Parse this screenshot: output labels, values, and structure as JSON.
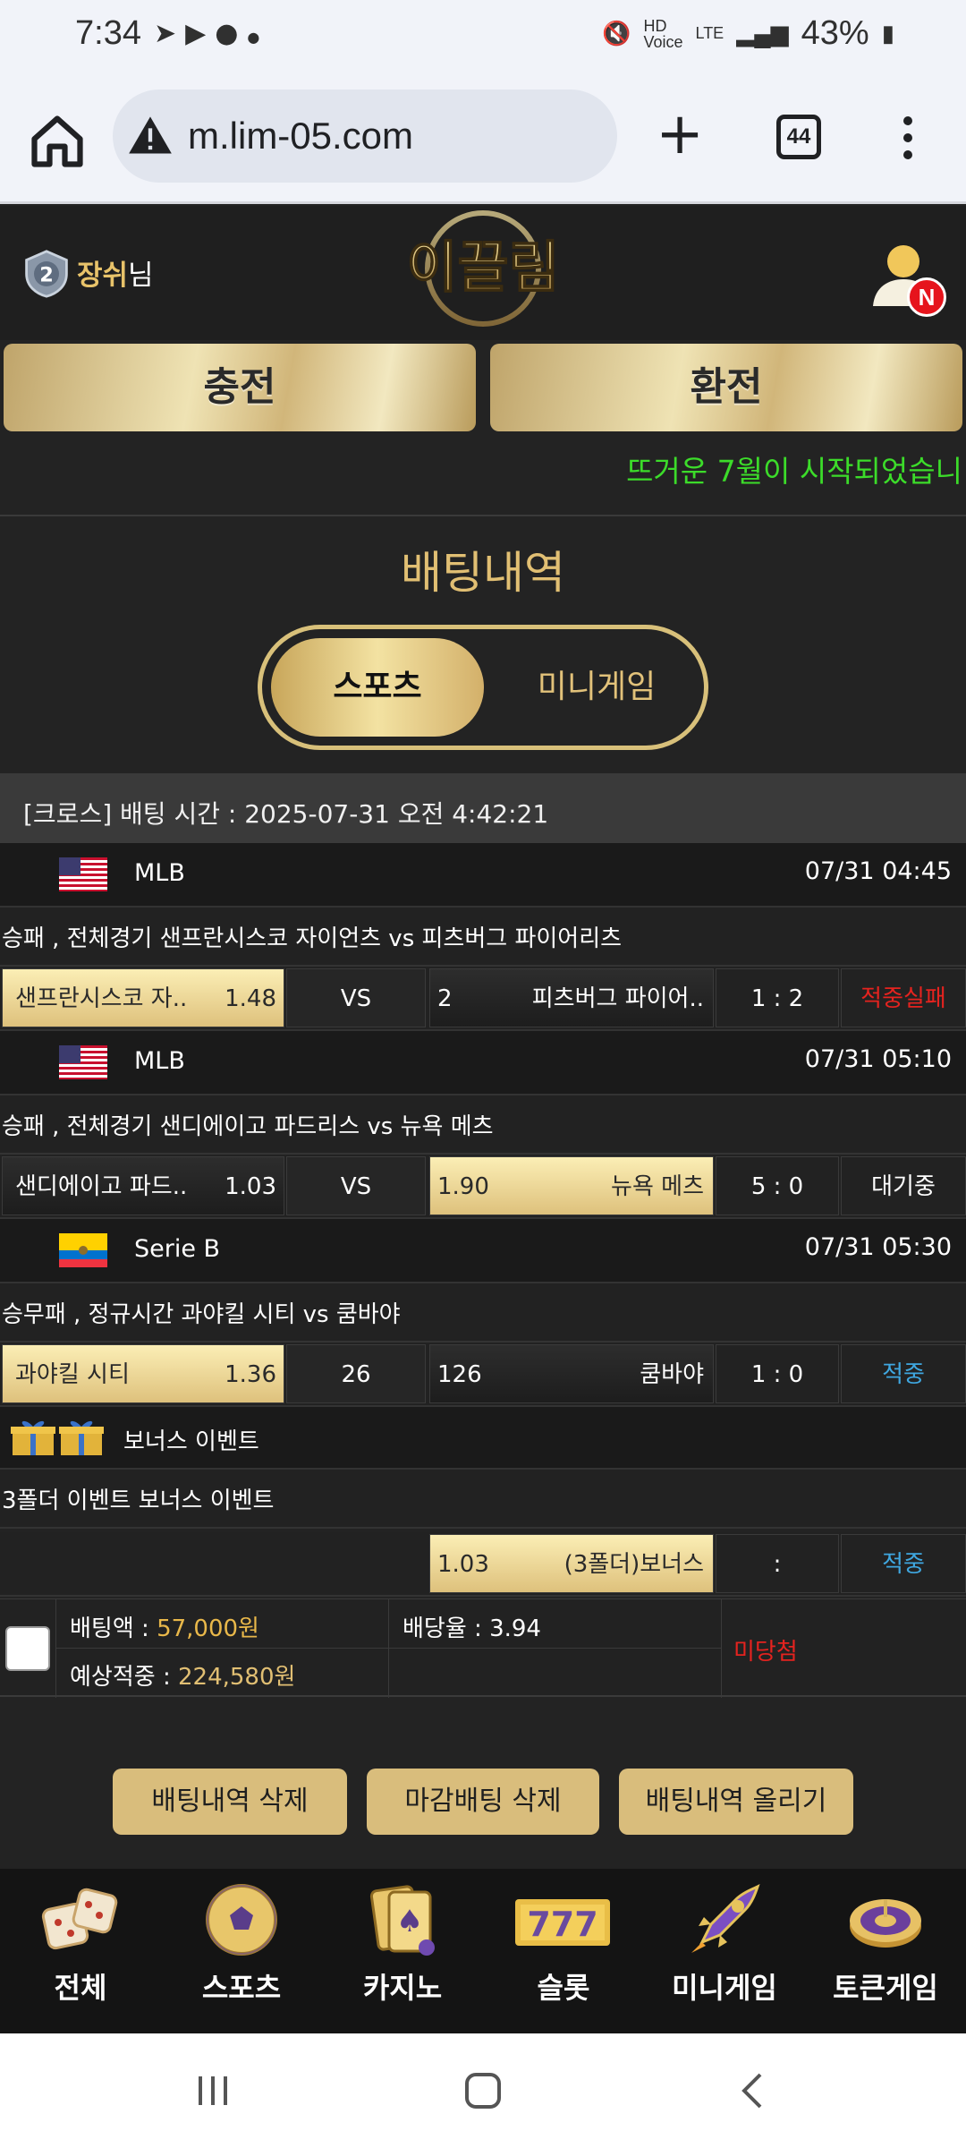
{
  "status_bar": {
    "time": "7:34",
    "battery": "43%",
    "notif_icons": [
      "telegram-icon",
      "youtube-icon",
      "kakaotalk-icon",
      "dot-icon"
    ]
  },
  "browser": {
    "url": "m.lim-05.com",
    "tab_count": "44"
  },
  "header": {
    "username": "장쉬",
    "username_suffix": "님",
    "rank_level": "2",
    "logo_text": "이끌림",
    "new_badge": "N"
  },
  "top_buttons": {
    "charge": "충전",
    "exchange": "환전"
  },
  "marquee": "뜨거운 7월이 시작되었습니",
  "page_title": "배팅내역",
  "segment": {
    "sports": "스포츠",
    "minigame": "미니게임"
  },
  "bet_header": "[크로스] 배팅 시간 : 2025-07-31 오전 4:42:21",
  "games": [
    {
      "league": "MLB",
      "flag": "us-flag",
      "time": "07/31 04:45",
      "desc": "승패 , 전체경기 샌프란시스코 자이언츠  vs  피츠버그 파이어리츠",
      "home": "샌프란시스코 자..",
      "home_odds": "1.48",
      "mid": "VS",
      "away_odds": "2",
      "away": "피츠버그 파이어..",
      "score": "1 : 2",
      "result": "적중실패",
      "selected": "home"
    },
    {
      "league": "MLB",
      "flag": "us-flag",
      "time": "07/31 05:10",
      "desc": "승패 , 전체경기 샌디에이고 파드리스  vs  뉴욕 메츠",
      "home": "샌디에이고 파드..",
      "home_odds": "1.03",
      "mid": "VS",
      "away_odds": "1.90",
      "away": "뉴욕 메츠",
      "score": "5 : 0",
      "result": "대기중",
      "selected": "away"
    },
    {
      "league": "Serie B",
      "flag": "ecuador-flag",
      "time": "07/31 05:30",
      "desc": "승무패 , 정규시간 과야킬 시티  vs  쿰바야",
      "home": "과야킬 시티",
      "home_odds": "1.36",
      "mid": "26",
      "away_odds": "126",
      "away": "쿰바야",
      "score": "1 : 0",
      "result": "적중",
      "selected": "home"
    }
  ],
  "bonus": {
    "title": "보너스 이벤트",
    "desc": "3폴더 이벤트 보너스 이벤트",
    "odds": "1.03",
    "label": "(3폴더)보너스",
    "score": ":",
    "result": "적중"
  },
  "summary": {
    "bet_amount_label": "배팅액 : ",
    "bet_amount": "57,000원",
    "odds_label": "배당율 : ",
    "odds": "3.94",
    "expected_label": "예상적중 : ",
    "expected": "224,580원",
    "status": "미당첨"
  },
  "actions": {
    "delete": "배팅내역 삭제",
    "delete_closed": "마감배팅 삭제",
    "post": "배팅내역 올리기"
  },
  "bottom_nav": [
    {
      "label": "전체",
      "icon": "dice-icon"
    },
    {
      "label": "스포츠",
      "icon": "soccer-ball-icon"
    },
    {
      "label": "카지노",
      "icon": "cards-icon"
    },
    {
      "label": "슬롯",
      "icon": "slot-777-icon"
    },
    {
      "label": "미니게임",
      "icon": "rocket-icon"
    },
    {
      "label": "토큰게임",
      "icon": "roulette-icon"
    }
  ],
  "colors": {
    "gold": "#e1bf73",
    "win": "#3fa7e0",
    "fail": "#e5231f",
    "marquee": "#3cdc2a"
  }
}
